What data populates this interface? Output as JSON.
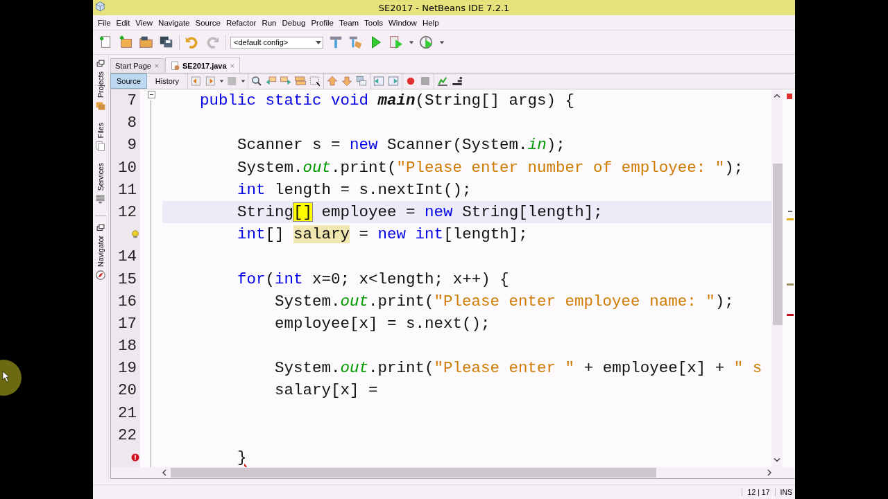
{
  "window": {
    "title": "SE2017 - NetBeans IDE 7.2.1"
  },
  "menu": [
    "File",
    "Edit",
    "View",
    "Navigate",
    "Source",
    "Refactor",
    "Run",
    "Debug",
    "Profile",
    "Team",
    "Tools",
    "Window",
    "Help"
  ],
  "toolbar": {
    "config": "<default config>"
  },
  "side_tabs": [
    "Projects",
    "Files",
    "Services",
    "Navigator"
  ],
  "tabs": [
    {
      "label": "Start Page",
      "selected": false
    },
    {
      "label": "SE2017.java",
      "selected": true
    }
  ],
  "editor_views": [
    {
      "label": "Source",
      "selected": true
    },
    {
      "label": "History",
      "selected": false
    }
  ],
  "code_lines": [
    {
      "number": "7",
      "current": false,
      "fold": true,
      "tokens": [
        {
          "kind": "keyword",
          "text": "    public static void "
        },
        {
          "kind": "method",
          "text": "main"
        },
        {
          "kind": "plain",
          "text": "(String[] args) {"
        }
      ]
    },
    {
      "number": "8",
      "current": false
    },
    {
      "number": "9",
      "current": false,
      "tokens": [
        {
          "kind": "plain",
          "text": "        Scanner s = "
        },
        {
          "kind": "keyword",
          "text": "new"
        },
        {
          "kind": "plain",
          "text": " Scanner(System."
        },
        {
          "kind": "field",
          "text": "in"
        },
        {
          "kind": "plain",
          "text": ");"
        }
      ]
    },
    {
      "number": "10",
      "current": false,
      "tokens": [
        {
          "kind": "plain",
          "text": "        System."
        },
        {
          "kind": "field",
          "text": "out"
        },
        {
          "kind": "plain",
          "text": ".print("
        },
        {
          "kind": "string",
          "text": "\"Please enter number of employee: \""
        },
        {
          "kind": "plain",
          "text": ");"
        }
      ]
    },
    {
      "number": "11",
      "current": false,
      "tokens": [
        {
          "kind": "keyword",
          "text": "        int"
        },
        {
          "kind": "plain",
          "text": " length = s.nextInt();"
        }
      ]
    },
    {
      "number": "12",
      "current": true,
      "tokens": [
        {
          "kind": "plain",
          "text": "        String"
        },
        {
          "kind": "match",
          "text": "[]"
        },
        {
          "kind": "plain",
          "text": " employee = "
        },
        {
          "kind": "keyword",
          "text": "new"
        },
        {
          "kind": "plain",
          "text": " String[length];"
        }
      ]
    },
    {
      "current": false,
      "hint": true,
      "tokens": [
        {
          "kind": "keyword",
          "text": "        int"
        },
        {
          "kind": "plain",
          "text": "[] "
        },
        {
          "kind": "occurrence",
          "text": "salary"
        },
        {
          "kind": "plain",
          "text": " = "
        },
        {
          "kind": "keyword",
          "text": "new int"
        },
        {
          "kind": "plain",
          "text": "[length];"
        }
      ]
    },
    {
      "number": "14",
      "current": false
    },
    {
      "number": "15",
      "current": false,
      "tokens": [
        {
          "kind": "keyword",
          "text": "        for"
        },
        {
          "kind": "plain",
          "text": "("
        },
        {
          "kind": "keyword",
          "text": "int"
        },
        {
          "kind": "plain",
          "text": " x=0; x<length; x++) {"
        }
      ]
    },
    {
      "number": "16",
      "current": false,
      "tokens": [
        {
          "kind": "plain",
          "text": "            System."
        },
        {
          "kind": "field",
          "text": "out"
        },
        {
          "kind": "plain",
          "text": ".print("
        },
        {
          "kind": "string",
          "text": "\"Please enter employee name: \""
        },
        {
          "kind": "plain",
          "text": ");"
        }
      ]
    },
    {
      "number": "17",
      "current": false,
      "tokens": [
        {
          "kind": "plain",
          "text": "            employee[x] = s.next();"
        }
      ]
    },
    {
      "number": "18",
      "current": false
    },
    {
      "number": "19",
      "current": false,
      "tokens": [
        {
          "kind": "plain",
          "text": "            System."
        },
        {
          "kind": "field",
          "text": "out"
        },
        {
          "kind": "plain",
          "text": ".print("
        },
        {
          "kind": "string",
          "text": "\"Please enter \""
        },
        {
          "kind": "plain",
          "text": " + employee[x] + "
        },
        {
          "kind": "string",
          "text": "\" s"
        }
      ]
    },
    {
      "number": "20",
      "current": false,
      "tokens": [
        {
          "kind": "plain",
          "text": "            salary[x] ="
        }
      ]
    },
    {
      "number": "21",
      "current": false
    },
    {
      "number": "22",
      "current": false
    },
    {
      "current": false,
      "error": true,
      "tokens": [
        {
          "kind": "error",
          "text": "        }"
        }
      ]
    }
  ],
  "status_bar": {
    "position": "12 | 17",
    "mode": "INS"
  }
}
